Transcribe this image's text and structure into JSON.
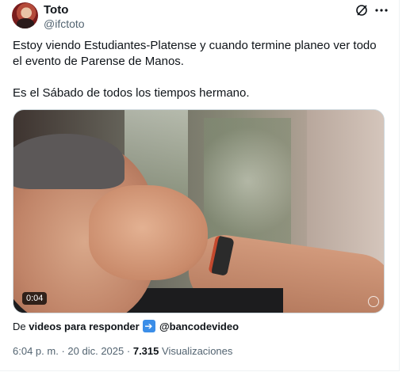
{
  "author": {
    "name": "Toto",
    "handle": "@ifctoto"
  },
  "tweet": {
    "paragraphs": [
      "Estoy viendo Estudiantes-Platense y cuando termine planeo ver todo el evento de Parense de Manos.",
      "Es el Sábado de todos los tiempos hermano."
    ]
  },
  "media": {
    "duration": "0:04"
  },
  "source": {
    "prefix": "De",
    "account_text": "videos para responder",
    "icon": "right-arrow-icon",
    "mention": "@bancodevideo"
  },
  "meta": {
    "time": "6:04 p. m.",
    "separator1": "·",
    "date": "20 dic. 2025",
    "separator2": "·",
    "views_count": "7.315",
    "views_label": "Visualizaciones"
  },
  "colors": {
    "text": "#0f1419",
    "secondary": "#536471",
    "arrow_icon_bg": "#3b8ee8"
  }
}
